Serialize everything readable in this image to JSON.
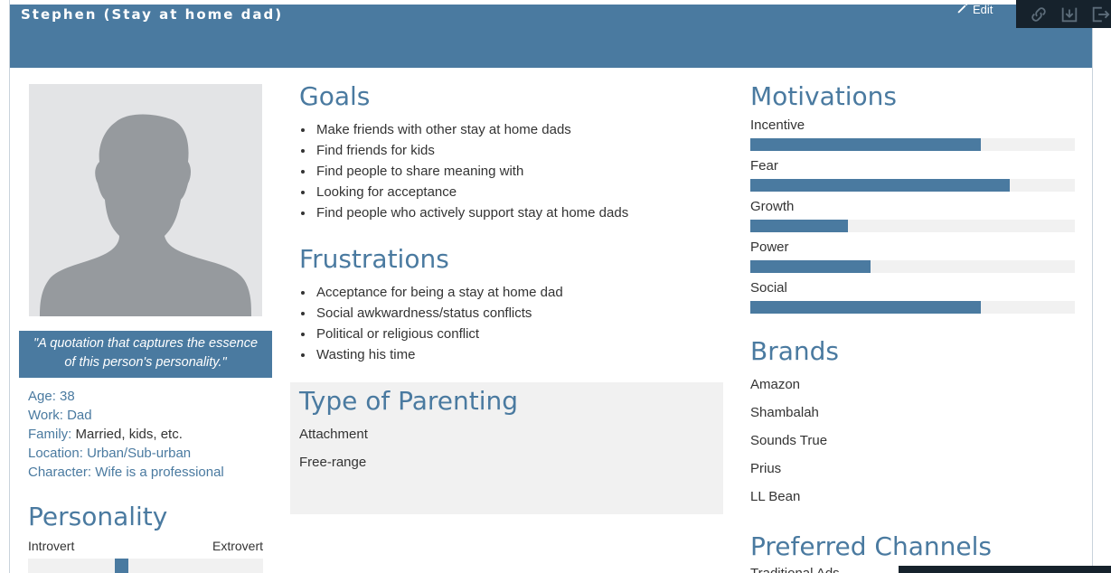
{
  "header": {
    "persona_name": "Stephen (Stay at home dad)",
    "edit_label": "Edit",
    "accent_color": "#4a7aa0",
    "toolbar_icons": [
      "link-icon",
      "download-icon",
      "share-exit-icon"
    ]
  },
  "profile": {
    "quote": "\"A quotation that captures the essence of this person's personality.\"",
    "facts": [
      {
        "key": "Age:",
        "value": "38",
        "value_style": "blue"
      },
      {
        "key": "Work:",
        "value": "Dad",
        "value_style": "blue"
      },
      {
        "key": "Family:",
        "value": "Married, kids, etc.",
        "value_style": "dark"
      },
      {
        "key": "Location:",
        "value": "Urban/Sub-urban",
        "value_style": "blue"
      },
      {
        "key": "Character:",
        "value": "Wife is a professional",
        "value_style": "blue"
      }
    ]
  },
  "personality": {
    "title": "Personality",
    "left_label": "Introvert",
    "right_label": "Extrovert",
    "value_fraction": 0.39
  },
  "goals": {
    "title": "Goals",
    "items": [
      "Make friends with other stay at home dads",
      "Find friends for kids",
      "Find people to share meaning with",
      "Looking for acceptance",
      "Find people who actively support stay at home dads"
    ]
  },
  "frustrations": {
    "title": "Frustrations",
    "items": [
      "Acceptance for being a stay at home dad",
      "Social awkwardness/status conflicts",
      "Political or religious conflict",
      "Wasting his time"
    ]
  },
  "parenting": {
    "title": "Type of Parenting",
    "items": [
      "Attachment",
      "Free-range"
    ]
  },
  "motivations": {
    "title": "Motivations",
    "items": [
      {
        "label": "Incentive",
        "value_fraction": 0.71
      },
      {
        "label": "Fear",
        "value_fraction": 0.8
      },
      {
        "label": "Growth",
        "value_fraction": 0.3
      },
      {
        "label": "Power",
        "value_fraction": 0.37
      },
      {
        "label": "Social",
        "value_fraction": 0.71
      }
    ]
  },
  "brands": {
    "title": "Brands",
    "items": [
      "Amazon",
      "Shambalah",
      "Sounds True",
      "Prius",
      "LL Bean"
    ]
  },
  "channels": {
    "title": "Preferred Channels",
    "first_item_partial": "Traditional Ads"
  }
}
